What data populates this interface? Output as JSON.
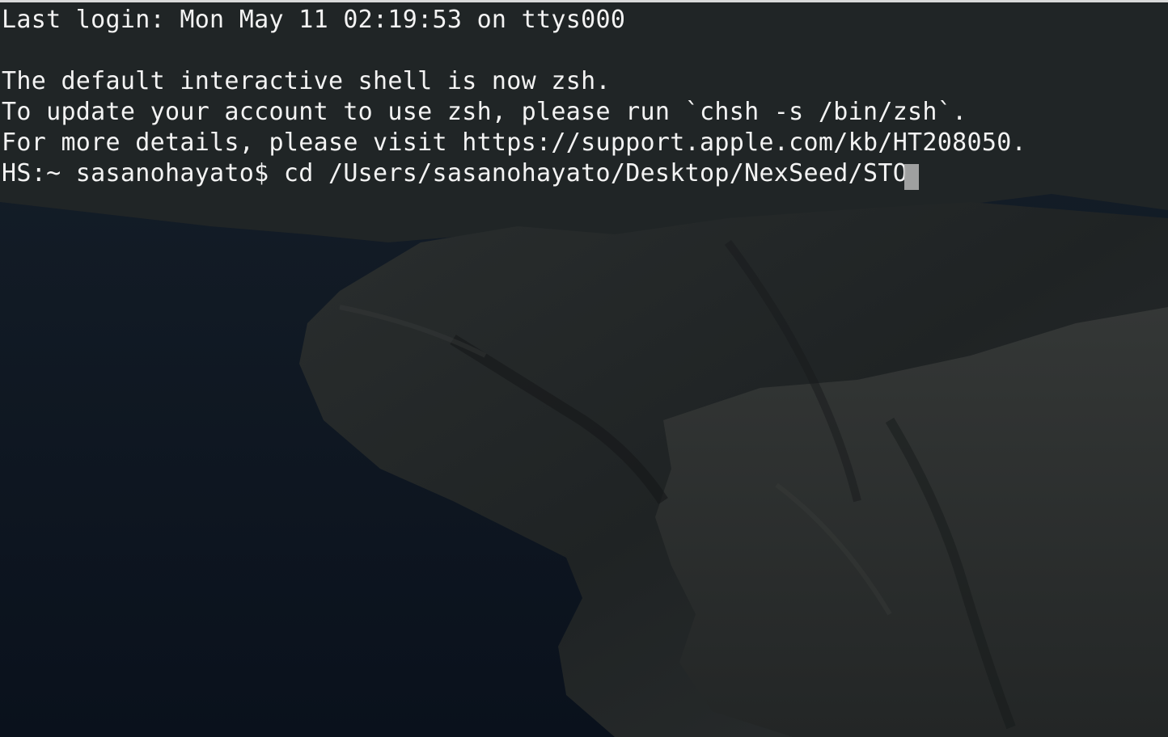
{
  "terminal": {
    "last_login": "Last login: Mon May 11 02:19:53 on ttys000",
    "notice_line1": "The default interactive shell is now zsh.",
    "notice_line2": "To update your account to use zsh, please run `chsh -s /bin/zsh`.",
    "notice_line3": "For more details, please visit https://support.apple.com/kb/HT208050.",
    "prompt": "HS:~ sasanohayato$ ",
    "command_input": "cd /Users/sasanohayato/Desktop/NexSeed/STO "
  },
  "colors": {
    "text": "#f3f3f3",
    "cursor": "#a7a7a7",
    "background_dark": "#101418"
  },
  "icons": {
    "cursor": "block-cursor"
  }
}
